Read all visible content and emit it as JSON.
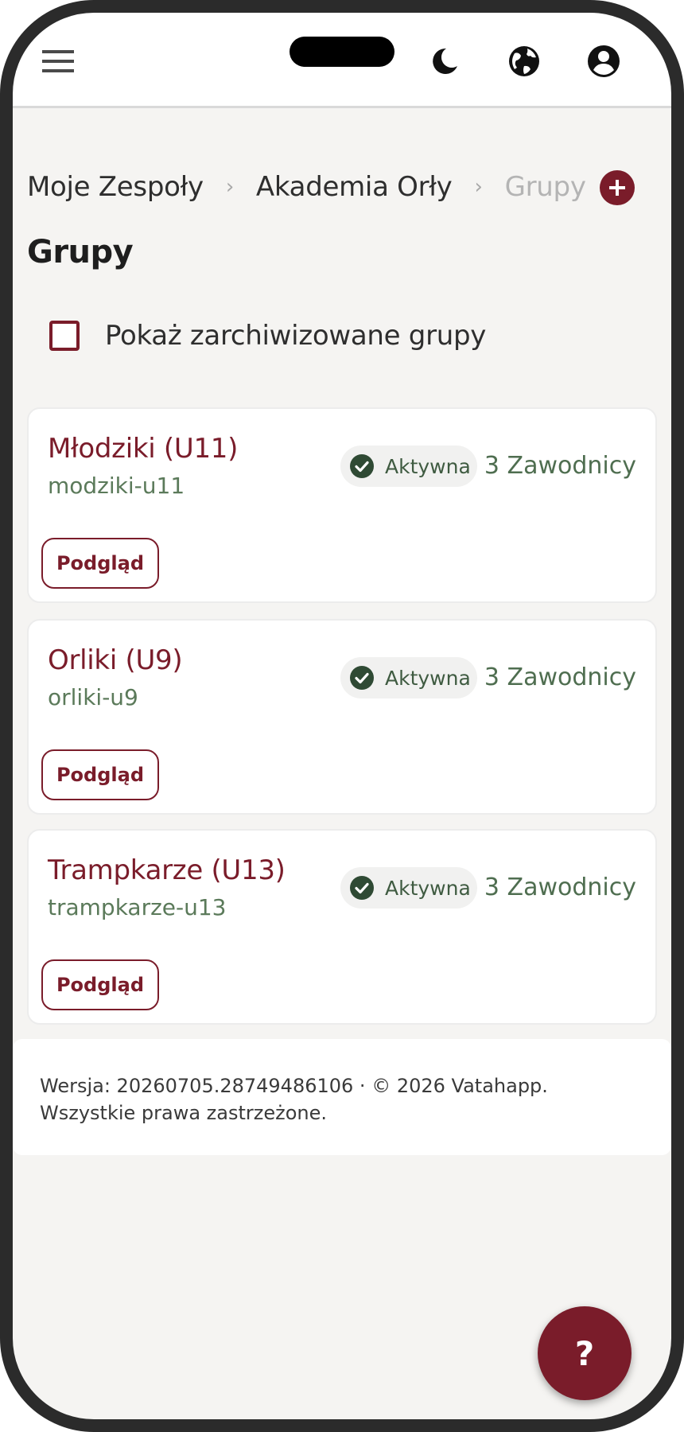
{
  "topbar": {
    "menu_icon": "menu-icon",
    "theme_icon": "moon-icon",
    "language_icon": "globe-icon",
    "account_icon": "account-circle-icon"
  },
  "breadcrumb": {
    "items": [
      "Moje Zespoły",
      "Akademia Orły",
      "Grupy"
    ],
    "separator": "›"
  },
  "add_icon": "add-circle-icon",
  "page_title": "Grupy",
  "archive_toggle": {
    "label": "Pokaż zarchiwizowane grupy",
    "checked": false
  },
  "groups": [
    {
      "name": "Młodziki (U11)",
      "slug": "modziki-u11",
      "status": "Aktywna",
      "players": "3 Zawodnicy",
      "action": "Podgląd"
    },
    {
      "name": "Orliki (U9)",
      "slug": "orliki-u9",
      "status": "Aktywna",
      "players": "3 Zawodnicy",
      "action": "Podgląd"
    },
    {
      "name": "Trampkarze (U13)",
      "slug": "trampkarze-u13",
      "status": "Aktywna",
      "players": "3 Zawodnicy",
      "action": "Podgląd"
    }
  ],
  "footer": {
    "line1": "Wersja: 20260705.28749486106 · © 2026 Vatahapp.",
    "line2": "Wszystkie prawa zastrzeżone."
  },
  "help_button": "?",
  "colors": {
    "primary": "#7a1c2a",
    "success": "#3f5b41",
    "background": "#f5f4f2"
  }
}
